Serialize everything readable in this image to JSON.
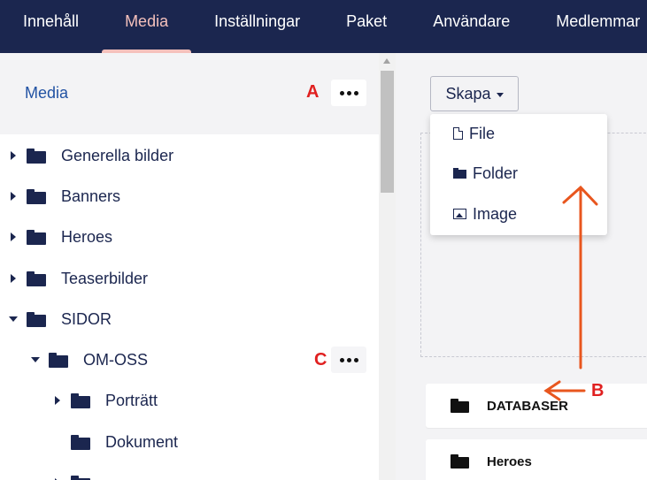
{
  "nav": {
    "items": [
      "Innehåll",
      "Media",
      "Inställningar",
      "Paket",
      "Användare",
      "Medlemmar"
    ],
    "active": "Media"
  },
  "tree": {
    "title": "Media",
    "items": [
      {
        "label": "Generella bilder",
        "expanded": false
      },
      {
        "label": "Banners",
        "expanded": false
      },
      {
        "label": "Heroes",
        "expanded": false
      },
      {
        "label": "Teaserbilder",
        "expanded": false
      },
      {
        "label": "SIDOR",
        "expanded": true
      },
      {
        "label": "OM-OSS",
        "expanded": true
      },
      {
        "label": "Porträtt",
        "expanded": false
      },
      {
        "label": "Dokument",
        "expanded": false
      }
    ]
  },
  "main": {
    "create_label": "Skapa",
    "menu": [
      {
        "label": "File",
        "icon": "file-icon"
      },
      {
        "label": "Folder",
        "icon": "folder-icon"
      },
      {
        "label": "Image",
        "icon": "image-icon"
      }
    ],
    "cards": [
      "DATABASER",
      "Heroes"
    ]
  },
  "annotations": {
    "a": "A",
    "b": "B",
    "c": "C",
    "color": "#e02020",
    "arrow_color": "#e8561e"
  },
  "colors": {
    "nav_bg": "#1b264f",
    "accent": "#f5c1bc",
    "link": "#2152a3"
  }
}
